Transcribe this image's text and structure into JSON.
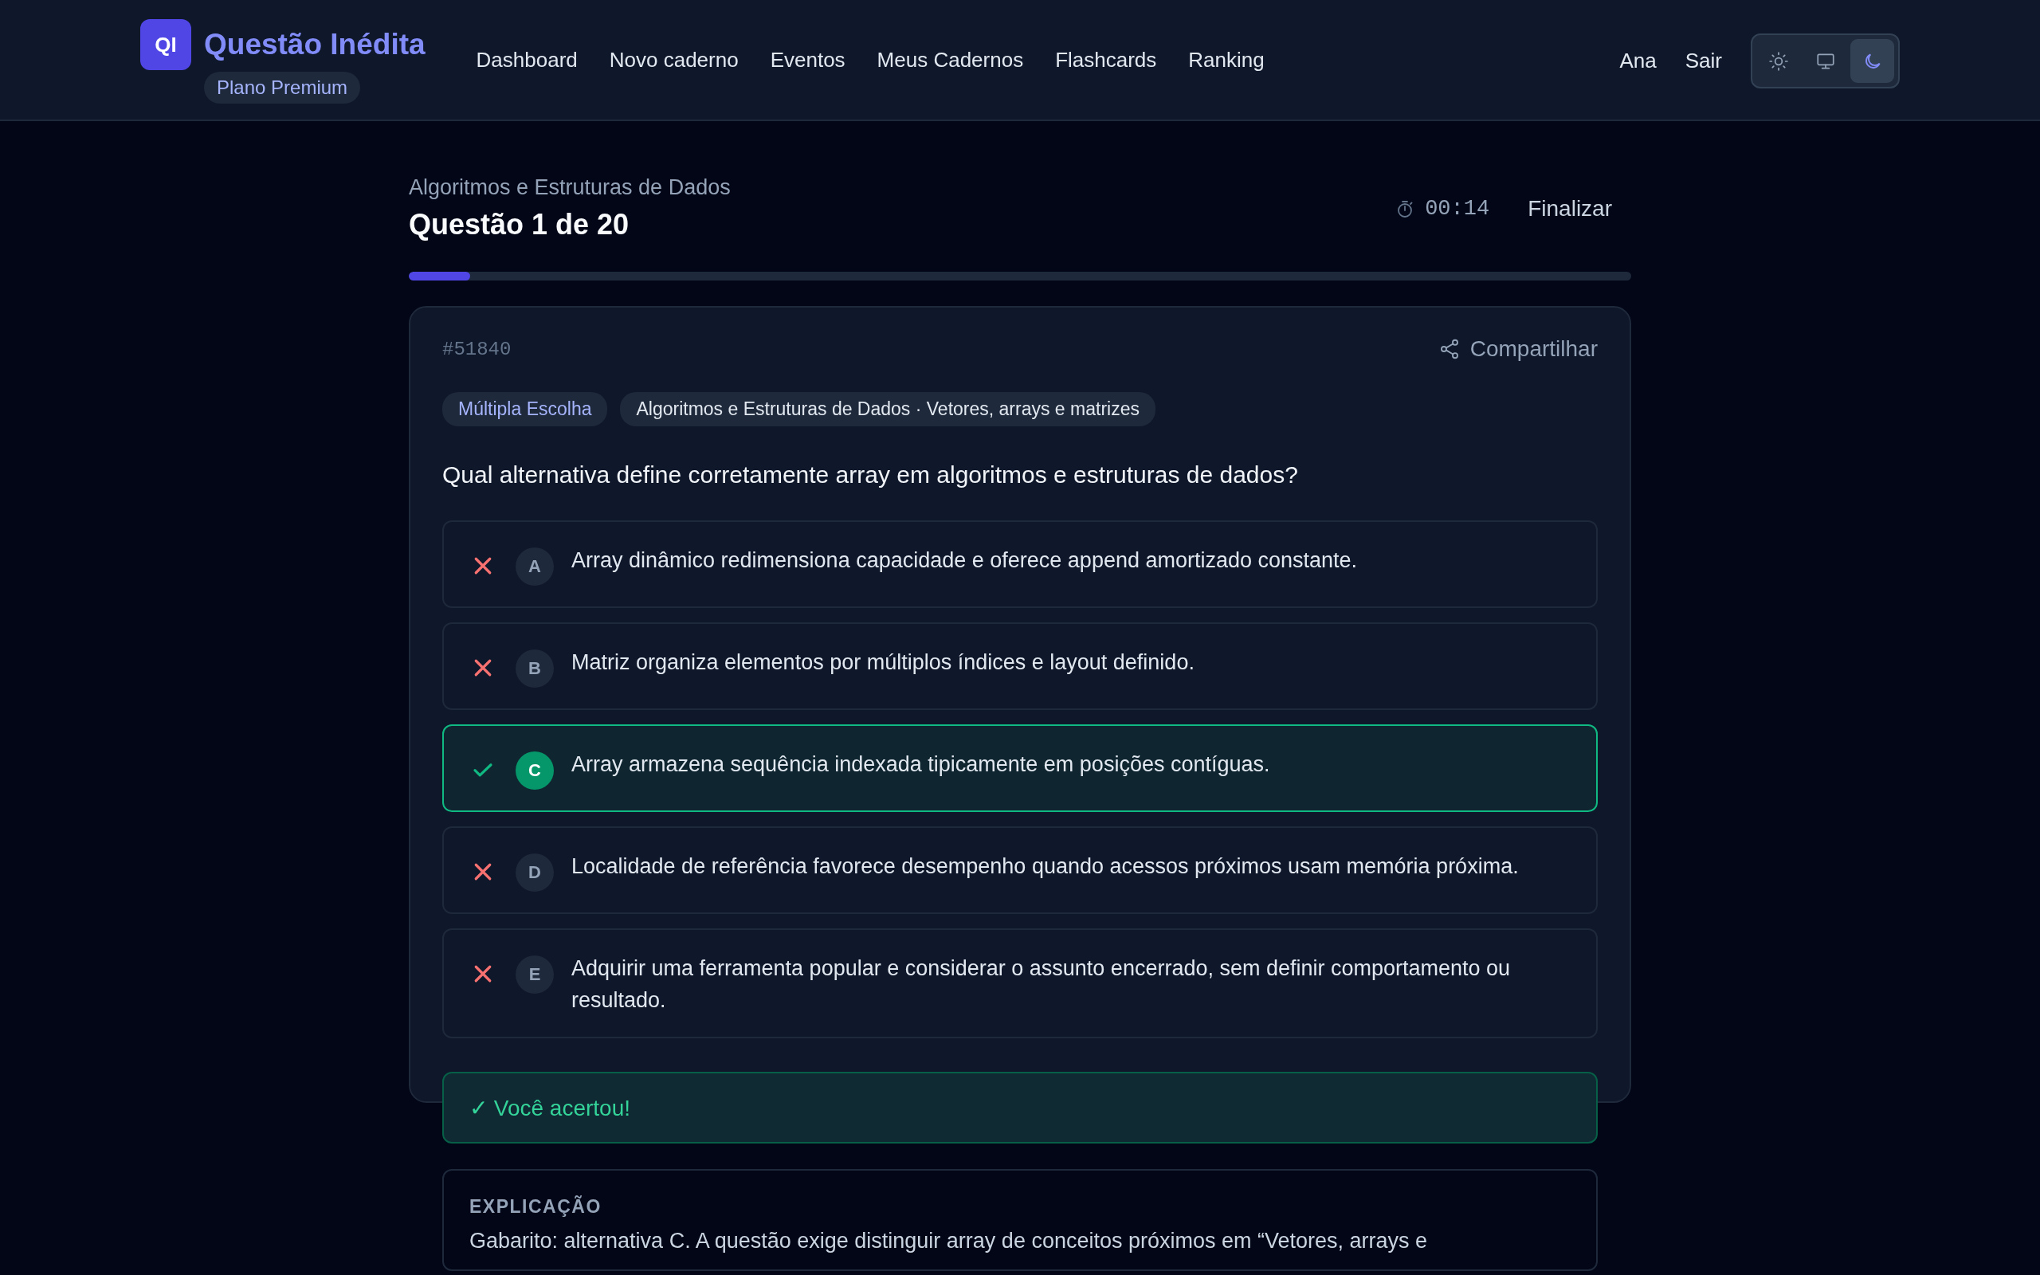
{
  "brand": {
    "logo": "QI",
    "name": "Questão Inédita",
    "plan": "Plano Premium"
  },
  "nav": [
    "Dashboard",
    "Novo caderno",
    "Eventos",
    "Meus Cadernos",
    "Flashcards",
    "Ranking"
  ],
  "user": {
    "name": "Ana",
    "logout": "Sair"
  },
  "theme_toggle": [
    {
      "kind": "light",
      "selected": false
    },
    {
      "kind": "system",
      "selected": false
    },
    {
      "kind": "dark",
      "selected": true
    }
  ],
  "quiz": {
    "subject": "Algoritmos e Estruturas de Dados",
    "title": "Questão 1 de 20",
    "timer": "00:14",
    "finish": "Finalizar",
    "progress": {
      "level": 0.05
    }
  },
  "question": {
    "id": "#51840",
    "share": "Compartilhar",
    "tags": [
      {
        "kind": "type",
        "label": "Múltipla Escolha"
      },
      {
        "kind": "topic",
        "label": "Algoritmos e Estruturas de Dados · Vetores, arrays e matrizes"
      }
    ],
    "text": "Qual alternativa define corretamente array em algoritmos e estruturas de dados?",
    "options": [
      {
        "letter": "A",
        "text": "Array dinâmico redimensiona capacidade e oferece append amortizado constante.",
        "correct": false
      },
      {
        "letter": "B",
        "text": "Matriz organiza elementos por múltiplos índices e layout definido.",
        "correct": false
      },
      {
        "letter": "C",
        "text": "Array armazena sequência indexada tipicamente em posições contíguas.",
        "correct": true
      },
      {
        "letter": "D",
        "text": "Localidade de referência favorece desempenho quando acessos próximos usam memória próxima.",
        "correct": false
      },
      {
        "letter": "E",
        "text": "Adquirir uma ferramenta popular e considerar o assunto encerrado, sem definir comportamento ou resultado.",
        "correct": false
      }
    ],
    "feedback": "✓ Você acertou!",
    "explanation": {
      "heading": "EXPLICAÇÃO",
      "text": "Gabarito: alternativa C. A questão exige distinguir array de conceitos próximos em “Vetores, arrays e"
    }
  }
}
